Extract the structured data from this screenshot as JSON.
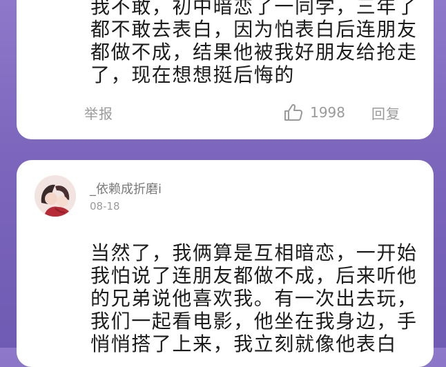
{
  "comments": [
    {
      "text": "我不敢，初中暗恋了一同学，三年了\n都不敢去表白，因为怕表白后连朋友\n都做不成，结果他被我好朋友给抢走\n了，现在想想挺后悔的",
      "report_label": "举报",
      "like_count": "1998",
      "reply_label": "回复",
      "icons": {
        "like": "thumbs-up-icon"
      }
    },
    {
      "username": "_依赖成折磨i",
      "date": "08-18",
      "text": "当然了，我俩算是互相暗恋，一开始\n我怕说了连朋友都做不成，后来听他\n的兄弟说他喜欢我。有一次出去玩，\n我们一起看电影，他坐在我身边，手\n悄悄搭了上来，我立刻就像他表白"
    }
  ],
  "colors": {
    "background_top": "#8e78c9",
    "background_bottom": "#6f5bb3",
    "card": "#ffffff",
    "text": "#1c1c1c",
    "muted": "#9a9a9a"
  }
}
